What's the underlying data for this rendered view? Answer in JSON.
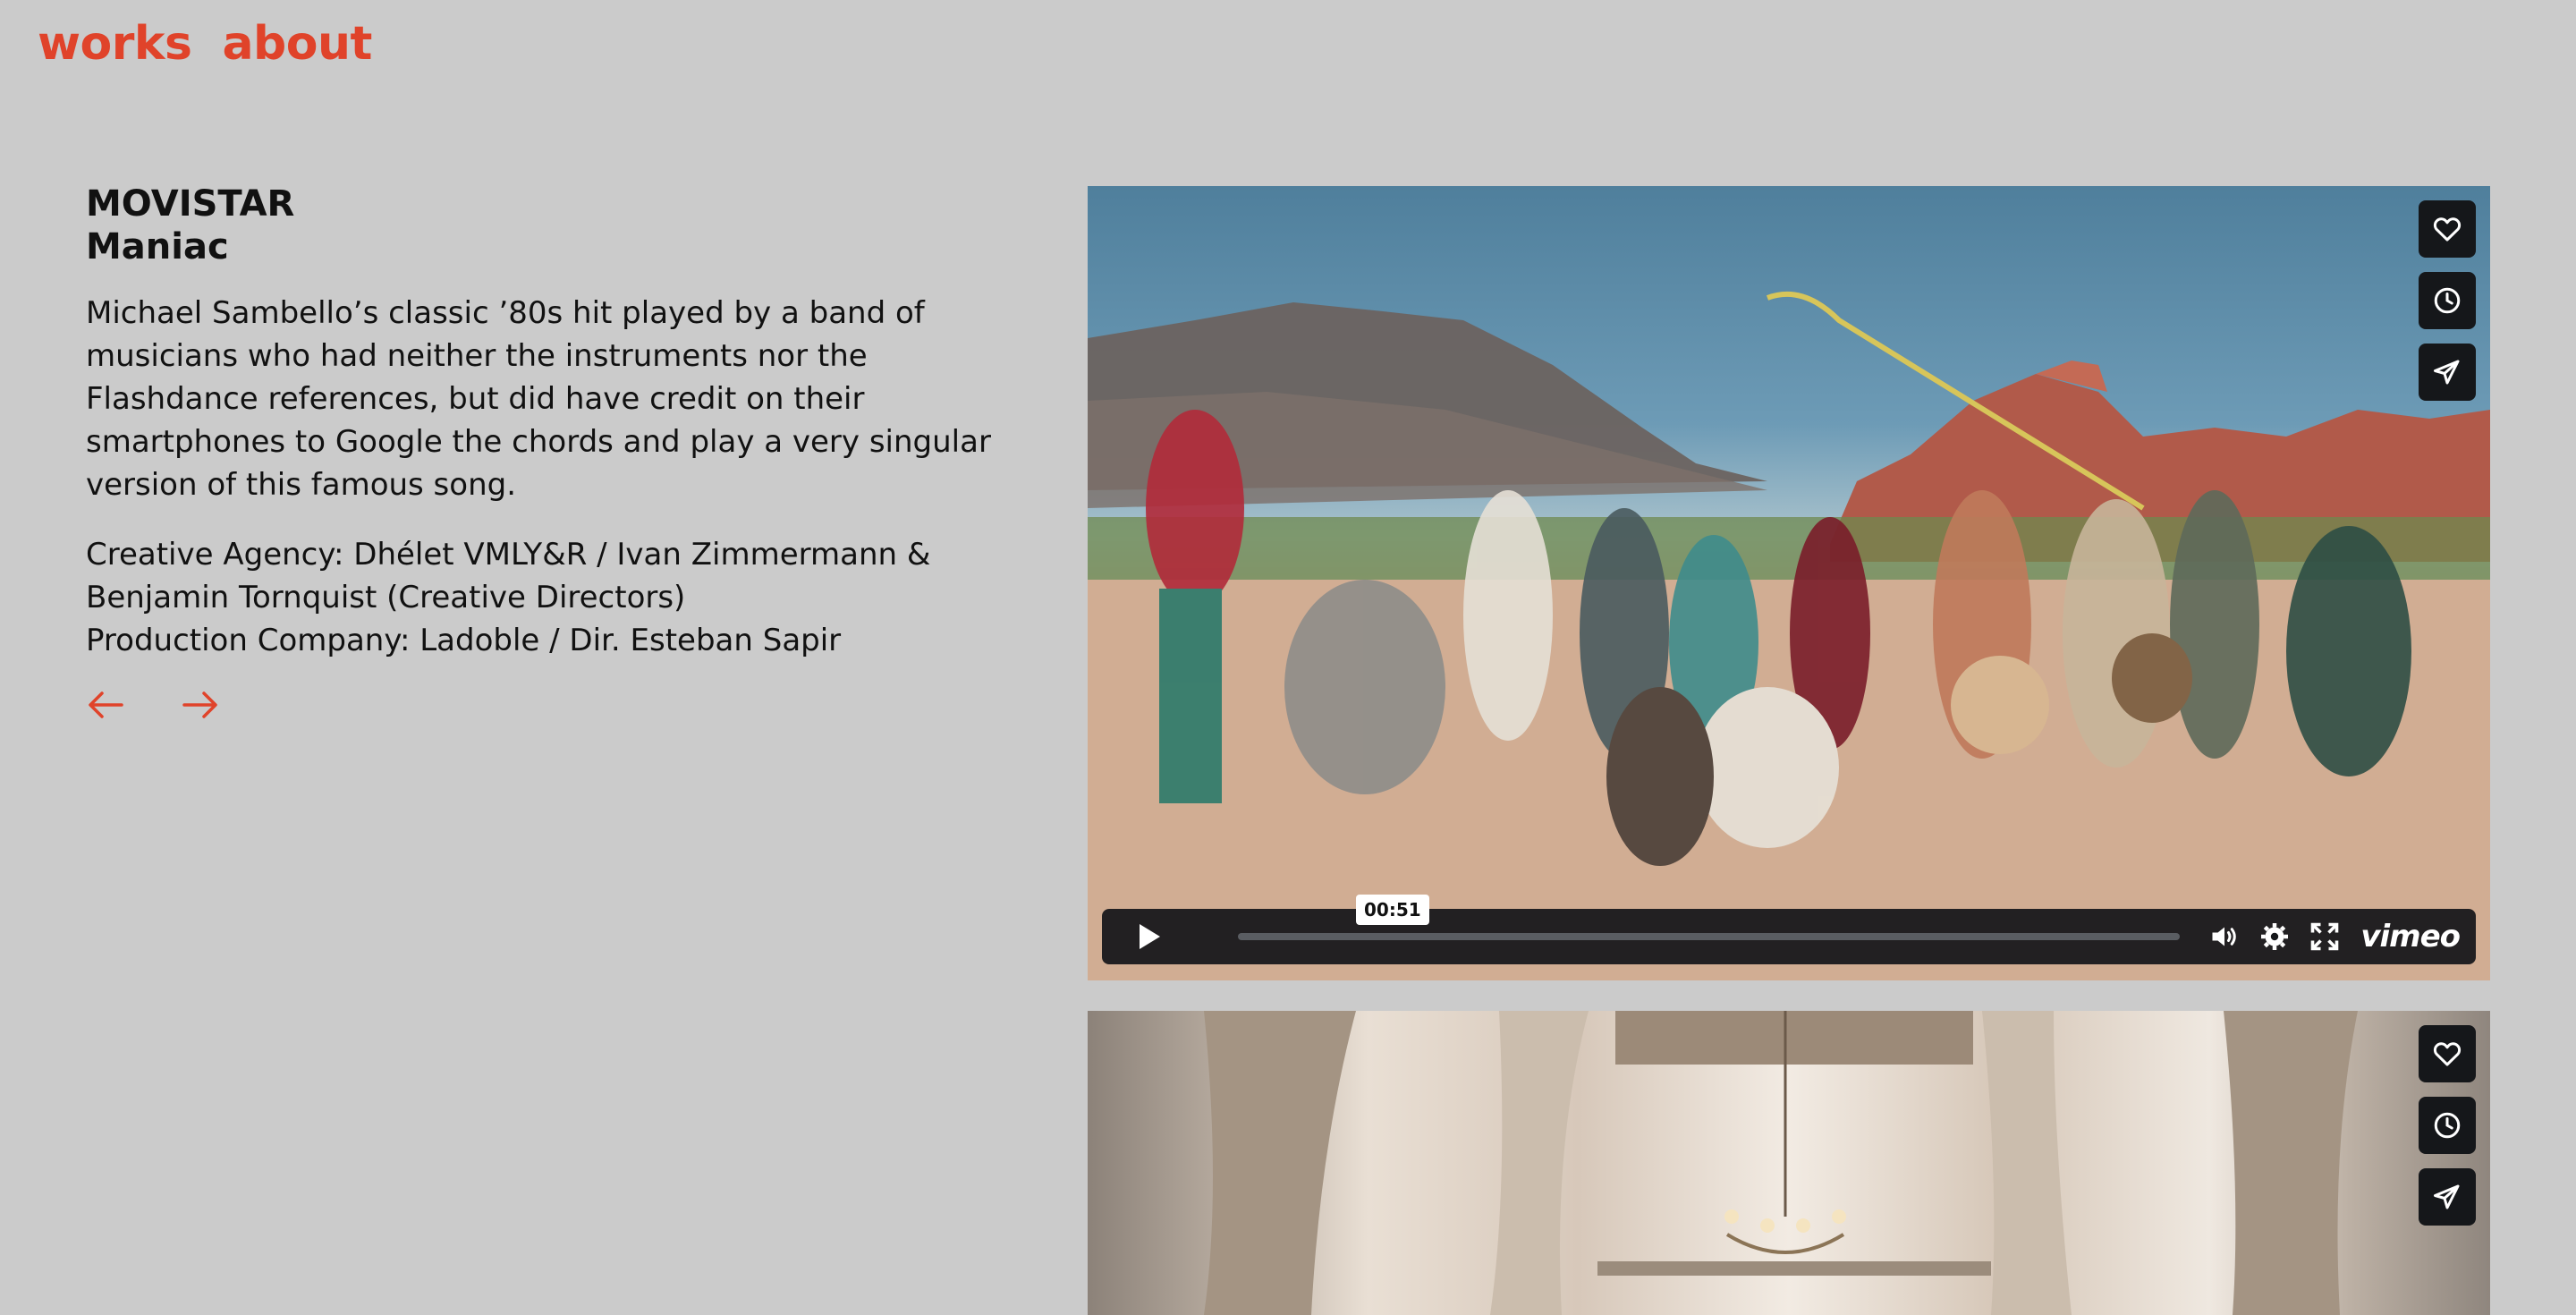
{
  "nav": {
    "works": "works",
    "about": "about"
  },
  "project": {
    "client": "MOVISTAR",
    "title": "Maniac",
    "description": "Michael Sambello’s classic ’80s hit played by a band of musicians who had neither the instruments nor the Flashdance references, but did have credit on their smartphones to Google the chords and play a very singular version of this famous song.",
    "credits": [
      "Creative Agency: Dhélet VMLY&R / Ivan Zimmermann &",
      "Benjamin Tornquist (Creative Directors)",
      "Production Company: Ladoble / Dir. Esteban Sapir"
    ]
  },
  "pager": {
    "prev_icon": "arrow-left-icon",
    "next_icon": "arrow-right-icon"
  },
  "player": {
    "time_tooltip": "00:51",
    "brand": "vimeo",
    "progress": 0,
    "icons": [
      "heart-icon",
      "clock-icon",
      "share-icon",
      "play-icon",
      "volume-icon",
      "settings-icon",
      "fullscreen-icon"
    ]
  },
  "colors": {
    "accent": "#e0432a",
    "background": "#cbcbcb",
    "player_bar": "#15171a"
  }
}
